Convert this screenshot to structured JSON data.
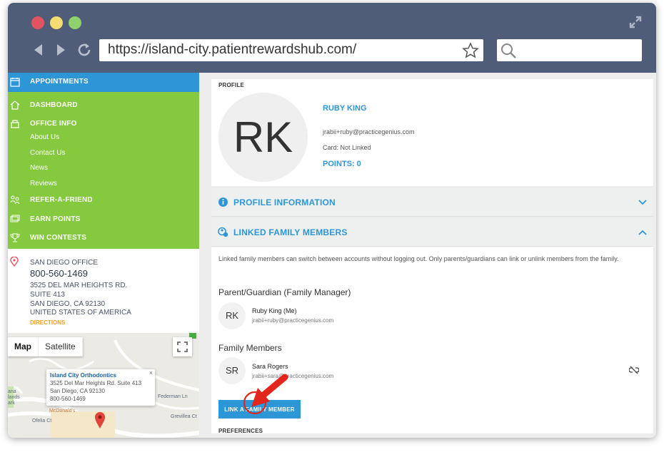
{
  "browser": {
    "url": "https://island-city.patientrewardshub.com/",
    "colors": {
      "chrome": "#4f5d79",
      "accent_blue": "#2d96d7",
      "accent_green": "#84c93e"
    }
  },
  "sidebar": {
    "appointments": "APPOINTMENTS",
    "dashboard": "DASHBOARD",
    "office_info": "OFFICE INFO",
    "sub_items": [
      "About Us",
      "Contact Us",
      "News",
      "Reviews"
    ],
    "refer": "REFER-A-FRIEND",
    "earn": "EARN POINTS",
    "win": "WIN CONTESTS"
  },
  "office": {
    "name": "SAN DIEGO OFFICE",
    "phone": "800-560-1469",
    "address1": "3525 DEL MAR HEIGHTS RD.",
    "address2": "SUITE 413",
    "city": "SAN DIEGO, CA 92130",
    "country": "UNITED STATES OF AMERICA",
    "directions": "DIRECTIONS"
  },
  "map": {
    "tab_map": "Map",
    "tab_satellite": "Satellite",
    "info_title": "Island City Orthodontics",
    "info_line1": "3525 Del Mar Heights Rd. Suite 413",
    "info_line2": "San Diego, CA 92130",
    "info_line3": "800-560-1469",
    "close": "×",
    "label_mcdonalds": "McDonald's",
    "label_federman": "Federman Ln",
    "label_grevillea": "Grevillea Ct",
    "label_ofelia": "Ofelia Ct",
    "label_lands": "ana\nlands\nark"
  },
  "profile": {
    "section": "PROFILE",
    "initials": "RK",
    "name": "RUBY KING",
    "email": "jrabii+ruby@practicegenius.com",
    "card": "Card: Not Linked",
    "points": "POINTS: 0"
  },
  "accordions": {
    "profile_info": "PROFILE INFORMATION",
    "linked": "LINKED FAMILY MEMBERS"
  },
  "linked": {
    "description": "Linked family members can switch between accounts without logging out. Only parents/guardians can link or unlink members from the family.",
    "guardian_heading": "Parent/Guardian (Family Manager)",
    "guardian": {
      "initials": "RK",
      "name": "Ruby King (Me)",
      "email": "jrabii+ruby@practicegenius.com"
    },
    "members_heading": "Family Members",
    "member": {
      "initials": "SR",
      "name": "Sara Rogers",
      "email": "jrabii+sara@practicegenius.com"
    },
    "button": "LINK A FAMILY MEMBER"
  },
  "preferences": "PREFERENCES"
}
